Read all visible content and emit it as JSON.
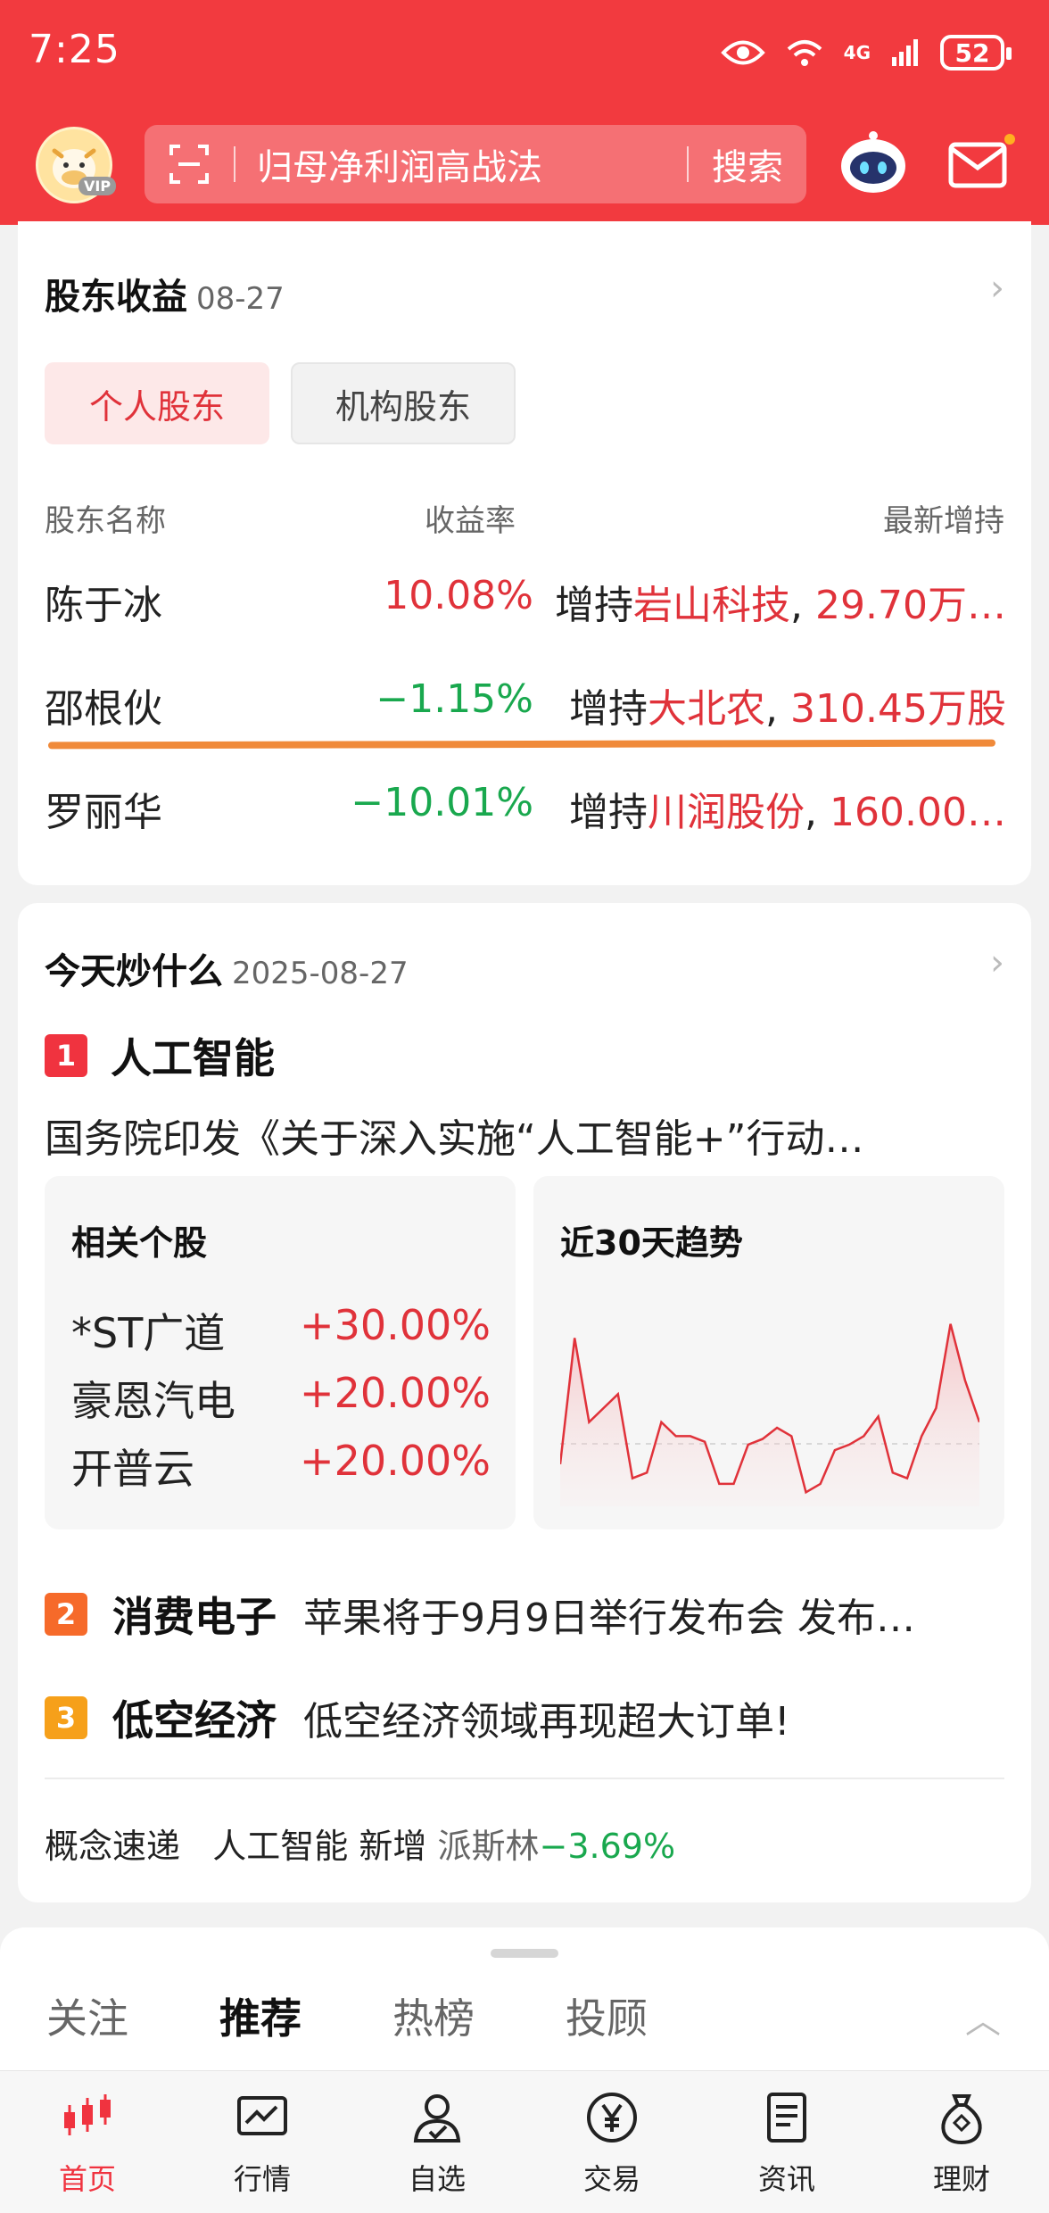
{
  "status_bar": {
    "time": "7:25",
    "network": "4G",
    "battery": "52"
  },
  "header": {
    "search_placeholder": "归母净利润高战法",
    "search_button": "搜索"
  },
  "shareholder_card": {
    "title": "股东收益",
    "date": "08-27",
    "tabs": [
      "个人股东",
      "机构股东"
    ],
    "columns": [
      "股东名称",
      "收益率",
      "最新增持"
    ],
    "rows": [
      {
        "name": "陈于冰",
        "rate": "10.08%",
        "rate_color": "#e0323a",
        "action": "增持",
        "stock": "岩山科技",
        "amount": "29.70万…"
      },
      {
        "name": "邵根伙",
        "rate": "−1.15%",
        "rate_color": "#19a84e",
        "action": "增持",
        "stock": "大北农",
        "amount": "310.45万股"
      },
      {
        "name": "罗丽华",
        "rate": "−10.01%",
        "rate_color": "#19a84e",
        "action": "增持",
        "stock": "川润股份",
        "amount": "160.00…"
      }
    ]
  },
  "today_card": {
    "title": "今天炒什么",
    "date": "2025-08-27",
    "topics": [
      {
        "rank": "1",
        "name": "人工智能",
        "desc": "国务院印发《关于深入实施“人工智能+”行动…"
      },
      {
        "rank": "2",
        "name": "消费电子",
        "desc": "苹果将于9月9日举行发布会 发布…"
      },
      {
        "rank": "3",
        "name": "低空经济",
        "desc": "低空经济领域再现超大订单!"
      }
    ],
    "related_title": "相关个股",
    "related_stocks": [
      {
        "name": "*ST广道",
        "change": "+30.00%"
      },
      {
        "name": "豪恩汽电",
        "change": "+20.00%"
      },
      {
        "name": "开普云",
        "change": "+20.00%"
      }
    ],
    "trend_title": "近30天趋势",
    "chart_data": {
      "type": "area",
      "title": "近30天趋势",
      "x": [
        1,
        2,
        3,
        4,
        5,
        6,
        7,
        8,
        9,
        10,
        11,
        12,
        13,
        14,
        15,
        16,
        17,
        18,
        19,
        20,
        21,
        22,
        23,
        24,
        25,
        26,
        27,
        28,
        29,
        30
      ],
      "values": [
        45,
        90,
        60,
        65,
        70,
        40,
        42,
        60,
        55,
        55,
        53,
        38,
        38,
        52,
        54,
        58,
        55,
        35,
        38,
        50,
        52,
        55,
        62,
        42,
        40,
        55,
        65,
        95,
        75,
        60
      ],
      "ylim": [
        30,
        100
      ],
      "line_color": "#e0323a"
    },
    "concept": {
      "label": "概念速递",
      "topic": "人工智能",
      "action": "新增",
      "stock": "派斯林",
      "change": "−3.69%"
    }
  },
  "feed_tabs": [
    "关注",
    "推荐",
    "热榜",
    "投顾"
  ],
  "feed_active": "推荐",
  "bottom_nav": [
    "首页",
    "行情",
    "自选",
    "交易",
    "资讯",
    "理财"
  ]
}
